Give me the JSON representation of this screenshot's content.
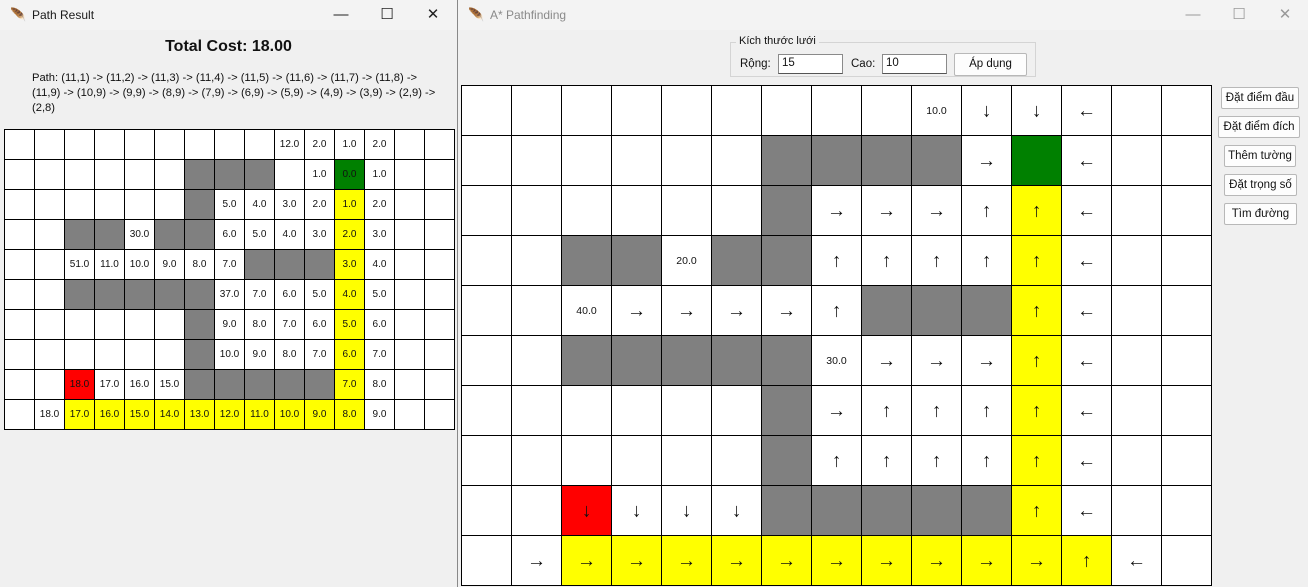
{
  "result_window": {
    "title": "Path Result",
    "icon": "feather-icon",
    "total_cost": "Total Cost: 18.00",
    "path_text": "Path: (11,1) -> (11,2) -> (11,3) -> (11,4) -> (11,5) -> (11,6) -> (11,7) -> (11,8) -> (11,9) -> (10,9) -> (9,9) -> (8,9) -> (7,9) -> (6,9) -> (5,9) -> (4,9) -> (3,9) -> (2,9) -> (2,8)",
    "grid": [
      [
        "",
        "",
        "",
        "",
        "",
        "",
        "",
        "",
        "",
        "12.0",
        "2.0",
        "1.0",
        "2.0",
        "",
        ""
      ],
      [
        "",
        "",
        "",
        "",
        "",
        "",
        "W",
        "W",
        "W",
        "",
        "1.0",
        "G:0.0",
        "1.0",
        "",
        ""
      ],
      [
        "",
        "",
        "",
        "",
        "",
        "",
        "W",
        "5.0",
        "4.0",
        "3.0",
        "2.0",
        "P:1.0",
        "2.0",
        "",
        ""
      ],
      [
        "",
        "",
        "W",
        "W",
        "30.0",
        "W",
        "W",
        "6.0",
        "5.0",
        "4.0",
        "3.0",
        "P:2.0",
        "3.0",
        "",
        ""
      ],
      [
        "",
        "",
        "51.0",
        "11.0",
        "10.0",
        "9.0",
        "8.0",
        "7.0",
        "W",
        "W",
        "W",
        "P:3.0",
        "4.0",
        "",
        ""
      ],
      [
        "",
        "",
        "W",
        "W",
        "W",
        "W",
        "W",
        "37.0",
        "7.0",
        "6.0",
        "5.0",
        "P:4.0",
        "5.0",
        "",
        ""
      ],
      [
        "",
        "",
        "",
        "",
        "",
        "",
        "W",
        "9.0",
        "8.0",
        "7.0",
        "6.0",
        "P:5.0",
        "6.0",
        "",
        ""
      ],
      [
        "",
        "",
        "",
        "",
        "",
        "",
        "W",
        "10.0",
        "9.0",
        "8.0",
        "7.0",
        "P:6.0",
        "7.0",
        "",
        ""
      ],
      [
        "",
        "",
        "S:18.0",
        "17.0",
        "16.0",
        "15.0",
        "W",
        "W",
        "W",
        "W",
        "W",
        "P:7.0",
        "8.0",
        "",
        ""
      ],
      [
        "",
        "18.0",
        "P:17.0",
        "P:16.0",
        "P:15.0",
        "P:14.0",
        "P:13.0",
        "P:12.0",
        "P:11.0",
        "P:10.0",
        "P:9.0",
        "P:8.0",
        "9.0",
        "",
        ""
      ]
    ]
  },
  "astar_window": {
    "title": "A* Pathfinding",
    "icon": "feather-icon",
    "grid_size_panel": {
      "title": "Kích thước lưới",
      "width_label": "Rộng:",
      "width_value": "15",
      "height_label": "Cao:",
      "height_value": "10",
      "apply_label": "Áp dụng"
    },
    "side_buttons": [
      "Đặt điểm đầu",
      "Đặt điểm đích",
      "Thêm tường",
      "Đặt trọng số",
      "Tìm đường"
    ],
    "grid": [
      [
        "",
        "",
        "",
        "",
        "",
        "",
        "",
        "",
        "",
        "10.0",
        "↓",
        "↓",
        "←",
        "",
        ""
      ],
      [
        "",
        "",
        "",
        "",
        "",
        "",
        "W",
        "W",
        "W",
        "W",
        "→",
        "G",
        "←",
        "",
        ""
      ],
      [
        "",
        "",
        "",
        "",
        "",
        "",
        "W",
        "→",
        "→",
        "→",
        "↑",
        "P:↑",
        "←",
        "",
        ""
      ],
      [
        "",
        "",
        "W",
        "W",
        "20.0",
        "W",
        "W",
        "↑",
        "↑",
        "↑",
        "↑",
        "P:↑",
        "←",
        "",
        ""
      ],
      [
        "",
        "",
        "40.0",
        "→",
        "→",
        "→",
        "→",
        "↑",
        "W",
        "W",
        "W",
        "P:↑",
        "←",
        "",
        ""
      ],
      [
        "",
        "",
        "W",
        "W",
        "W",
        "W",
        "W",
        "30.0",
        "→",
        "→",
        "→",
        "P:↑",
        "←",
        "",
        ""
      ],
      [
        "",
        "",
        "",
        "",
        "",
        "",
        "W",
        "→",
        "↑",
        "↑",
        "↑",
        "P:↑",
        "←",
        "",
        ""
      ],
      [
        "",
        "",
        "",
        "",
        "",
        "",
        "W",
        "↑",
        "↑",
        "↑",
        "↑",
        "P:↑",
        "←",
        "",
        ""
      ],
      [
        "",
        "",
        "S:↓",
        "↓",
        "↓",
        "↓",
        "W",
        "W",
        "W",
        "W",
        "W",
        "P:↑",
        "←",
        "",
        ""
      ],
      [
        "",
        "→",
        "P:→",
        "P:→",
        "P:→",
        "P:→",
        "P:→",
        "P:→",
        "P:→",
        "P:→",
        "P:→",
        "P:→",
        "P:↑",
        "←",
        ""
      ]
    ]
  }
}
